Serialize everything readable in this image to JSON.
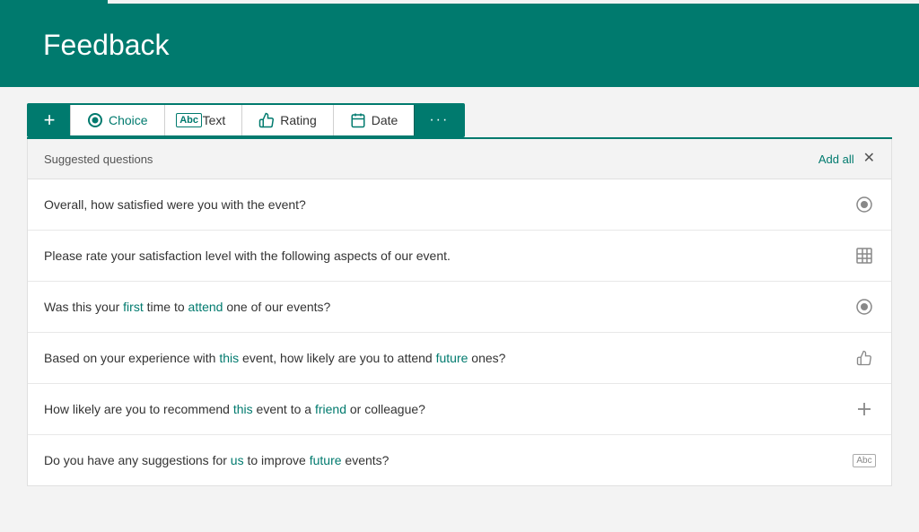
{
  "header": {
    "title": "Feedback"
  },
  "toolbar": {
    "add_label": "+",
    "more_label": "···",
    "buttons": [
      {
        "id": "choice",
        "label": "Choice",
        "icon": "choice"
      },
      {
        "id": "text",
        "label": "Text",
        "icon": "text"
      },
      {
        "id": "rating",
        "label": "Rating",
        "icon": "rating"
      },
      {
        "id": "date",
        "label": "Date",
        "icon": "date"
      }
    ]
  },
  "suggested": {
    "section_title": "Suggested questions",
    "add_all_label": "Add all",
    "questions": [
      {
        "text": "Overall, how satisfied were you with the event?",
        "icon": "radio",
        "highlight_words": []
      },
      {
        "text": "Please rate your satisfaction level with the following aspects of our event.",
        "icon": "grid",
        "highlight_words": []
      },
      {
        "text": "Was this your first time to attend one of our events?",
        "icon": "radio",
        "highlight_words": [
          "first",
          "attend"
        ]
      },
      {
        "text": "Based on your experience with this event, how likely are you to attend future ones?",
        "icon": "thumb",
        "highlight_words": [
          "this",
          "future"
        ]
      },
      {
        "text": "How likely are you to recommend this event to a friend or colleague?",
        "icon": "plus",
        "highlight_words": [
          "this",
          "friend"
        ]
      },
      {
        "text": "Do you have any suggestions for us to improve future events?",
        "icon": "text",
        "highlight_words": [
          "us",
          "future"
        ]
      }
    ]
  }
}
